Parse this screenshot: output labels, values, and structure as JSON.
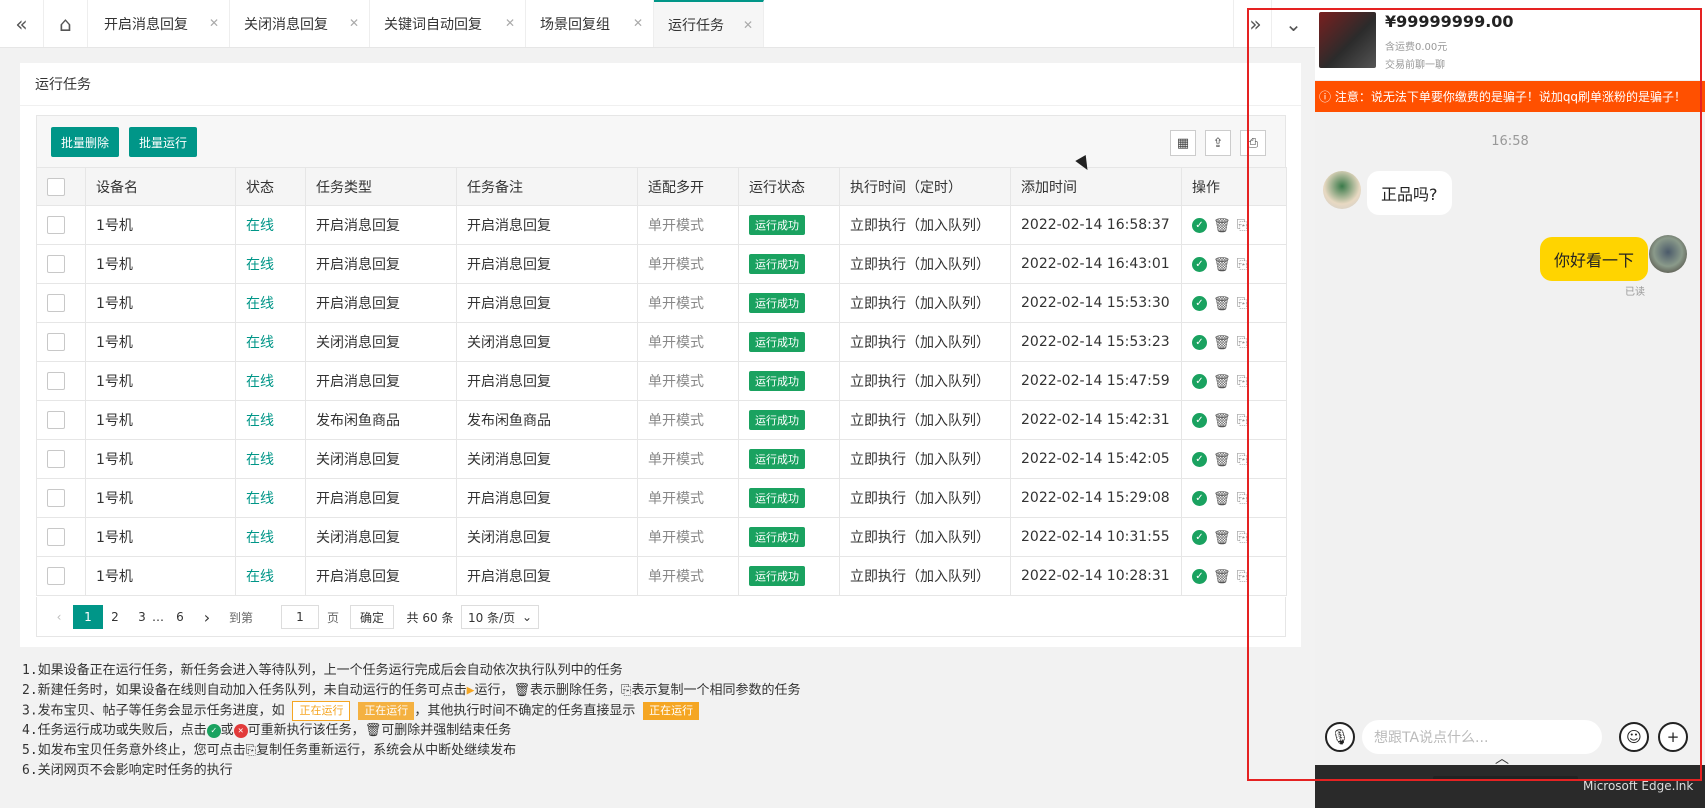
{
  "tabs": [
    {
      "label": "开启消息回复"
    },
    {
      "label": "关闭消息回复"
    },
    {
      "label": "关键词自动回复"
    },
    {
      "label": "场景回复组"
    },
    {
      "label": "运行任务"
    }
  ],
  "card": {
    "title": "运行任务"
  },
  "toolbar": {
    "batch_delete": "批量删除",
    "batch_run": "批量运行"
  },
  "table": {
    "columns": [
      "设备名",
      "状态",
      "任务类型",
      "任务备注",
      "适配多开",
      "运行状态",
      "执行时间（定时）",
      "添加时间",
      "操作"
    ],
    "rows": [
      {
        "device": "1号机",
        "status": "在线",
        "type": "开启消息回复",
        "remark": "开启消息回复",
        "mode": "单开模式",
        "run": "运行成功",
        "exec": "立即执行（加入队列）",
        "added": "2022-02-14 16:58:37"
      },
      {
        "device": "1号机",
        "status": "在线",
        "type": "开启消息回复",
        "remark": "开启消息回复",
        "mode": "单开模式",
        "run": "运行成功",
        "exec": "立即执行（加入队列）",
        "added": "2022-02-14 16:43:01"
      },
      {
        "device": "1号机",
        "status": "在线",
        "type": "开启消息回复",
        "remark": "开启消息回复",
        "mode": "单开模式",
        "run": "运行成功",
        "exec": "立即执行（加入队列）",
        "added": "2022-02-14 15:53:30"
      },
      {
        "device": "1号机",
        "status": "在线",
        "type": "关闭消息回复",
        "remark": "关闭消息回复",
        "mode": "单开模式",
        "run": "运行成功",
        "exec": "立即执行（加入队列）",
        "added": "2022-02-14 15:53:23"
      },
      {
        "device": "1号机",
        "status": "在线",
        "type": "开启消息回复",
        "remark": "开启消息回复",
        "mode": "单开模式",
        "run": "运行成功",
        "exec": "立即执行（加入队列）",
        "added": "2022-02-14 15:47:59"
      },
      {
        "device": "1号机",
        "status": "在线",
        "type": "发布闲鱼商品",
        "remark": "发布闲鱼商品",
        "mode": "单开模式",
        "run": "运行成功",
        "exec": "立即执行（加入队列）",
        "added": "2022-02-14 15:42:31"
      },
      {
        "device": "1号机",
        "status": "在线",
        "type": "关闭消息回复",
        "remark": "关闭消息回复",
        "mode": "单开模式",
        "run": "运行成功",
        "exec": "立即执行（加入队列）",
        "added": "2022-02-14 15:42:05"
      },
      {
        "device": "1号机",
        "status": "在线",
        "type": "开启消息回复",
        "remark": "开启消息回复",
        "mode": "单开模式",
        "run": "运行成功",
        "exec": "立即执行（加入队列）",
        "added": "2022-02-14 15:29:08"
      },
      {
        "device": "1号机",
        "status": "在线",
        "type": "关闭消息回复",
        "remark": "关闭消息回复",
        "mode": "单开模式",
        "run": "运行成功",
        "exec": "立即执行（加入队列）",
        "added": "2022-02-14 10:31:55"
      },
      {
        "device": "1号机",
        "status": "在线",
        "type": "开启消息回复",
        "remark": "开启消息回复",
        "mode": "单开模式",
        "run": "运行成功",
        "exec": "立即执行（加入队列）",
        "added": "2022-02-14 10:28:31"
      }
    ]
  },
  "pager": {
    "pages": [
      "1",
      "2",
      "3",
      "…",
      "6"
    ],
    "goto_label": "到第",
    "goto_value": "1",
    "page_unit": "页",
    "confirm": "确定",
    "total": "共 60 条",
    "page_size": "10 条/页"
  },
  "notes": {
    "n1": "1.如果设备正在运行任务，新任务会进入等待队列，上一个任务运行完成后会自动依次执行队列中的任务",
    "n2a": "2.新建任务时，如果设备在线则自动加入任务队列，未自动运行的任务可点击",
    "n2b": "运行，",
    "n2c": "表示删除任务，",
    "n2d": "表示复制一个相同参数的任务",
    "n3a": "3.发布宝贝、帖子等任务会显示任务进度，如",
    "n3chip1": "正在运行",
    "n3chip2": "正在运行",
    "n3b": "，其他执行时间不确定的任务直接显示",
    "n3chip3": "正在运行",
    "n4a": "4.任务运行成功或失败后，点击",
    "n4b": "或",
    "n4c": "可重新执行该任务，",
    "n4d": "可删除并强制结束任务",
    "n5a": "5.如发布宝贝任务意外终止，您可点击",
    "n5b": "复制任务重新运行，系统会从中断处继续发布",
    "n6": "6.关闭网页不会影响定时任务的执行"
  },
  "phone": {
    "price": "¥99999999.00",
    "shipping": "含运费0.00元",
    "chat_hint": "交易前聊一聊",
    "warning": "ⓘ 注意：说无法下单要你缴费的是骗子！说加qq刷单涨粉的是骗子！",
    "time": "16:58",
    "seller_msg": "正品吗?",
    "my_msg": "你好看一下",
    "read": "已读",
    "input_placeholder": "想跟TA说点什么...",
    "edge_text": "Microsoft Edge.lnk"
  },
  "colors": {
    "accent": "#009688",
    "success": "#1aa260",
    "warn": "#ff5000",
    "highlight": "#e52222",
    "bubble": "#ffd400"
  }
}
